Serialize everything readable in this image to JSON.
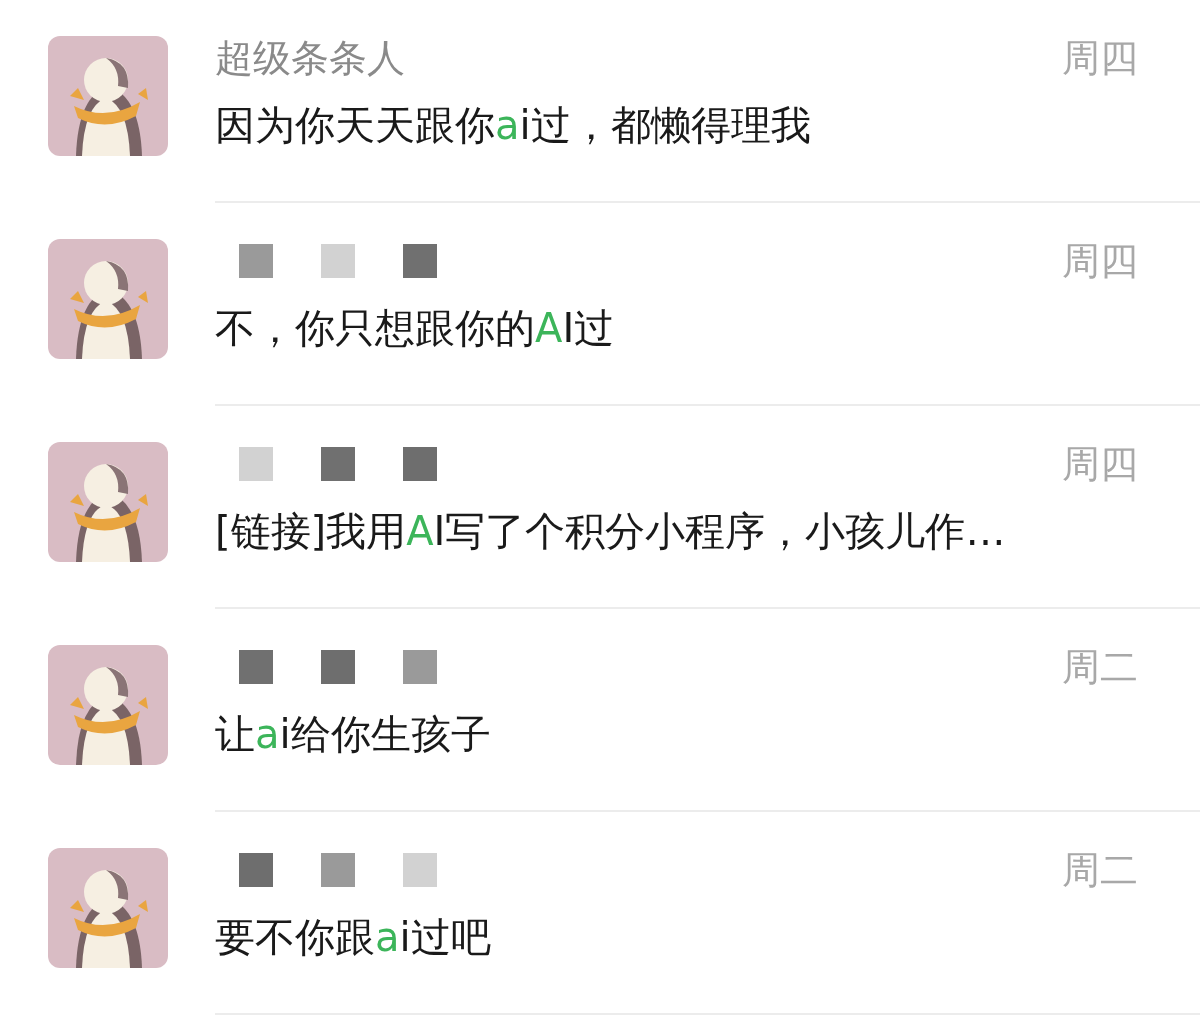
{
  "chats": [
    {
      "name": "超级条条人",
      "redacted": false,
      "time": "周四",
      "message": [
        {
          "text": "因为你天天跟你",
          "highlight": false
        },
        {
          "text": "a",
          "highlight": true
        },
        {
          "text": "i过，都懒得理我",
          "highlight": false
        }
      ]
    },
    {
      "redacted": true,
      "time": "周四",
      "message": [
        {
          "text": "不，你只想跟你的",
          "highlight": false
        },
        {
          "text": "A",
          "highlight": true
        },
        {
          "text": "I过",
          "highlight": false
        }
      ]
    },
    {
      "redacted": true,
      "time": "周四",
      "message": [
        {
          "text": "[链接]我用",
          "highlight": false
        },
        {
          "text": "A",
          "highlight": true
        },
        {
          "text": "I写了个积分小程序，小孩儿作…",
          "highlight": false
        }
      ]
    },
    {
      "redacted": true,
      "time": "周二",
      "message": [
        {
          "text": "让",
          "highlight": false
        },
        {
          "text": "a",
          "highlight": true
        },
        {
          "text": "i给你生孩子",
          "highlight": false
        }
      ]
    },
    {
      "redacted": true,
      "time": "周二",
      "message": [
        {
          "text": "要不你跟",
          "highlight": false
        },
        {
          "text": "a",
          "highlight": true
        },
        {
          "text": "i过吧",
          "highlight": false
        }
      ]
    }
  ]
}
